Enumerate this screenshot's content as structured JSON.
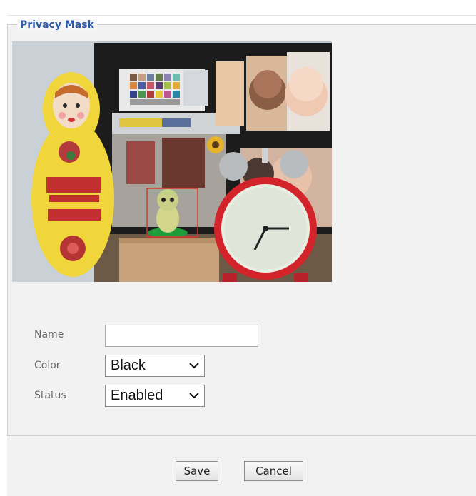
{
  "fieldset": {
    "legend": "Privacy Mask"
  },
  "preview": {
    "mask_color": "#d8372f"
  },
  "form": {
    "name": {
      "label": "Name",
      "value": ""
    },
    "color": {
      "label": "Color",
      "value": "Black"
    },
    "status": {
      "label": "Status",
      "value": "Enabled"
    }
  },
  "buttons": {
    "save": "Save",
    "cancel": "Cancel"
  },
  "theme": {
    "legend_color": "#2a5aa8",
    "panel_bg": "#f2f2f2"
  }
}
